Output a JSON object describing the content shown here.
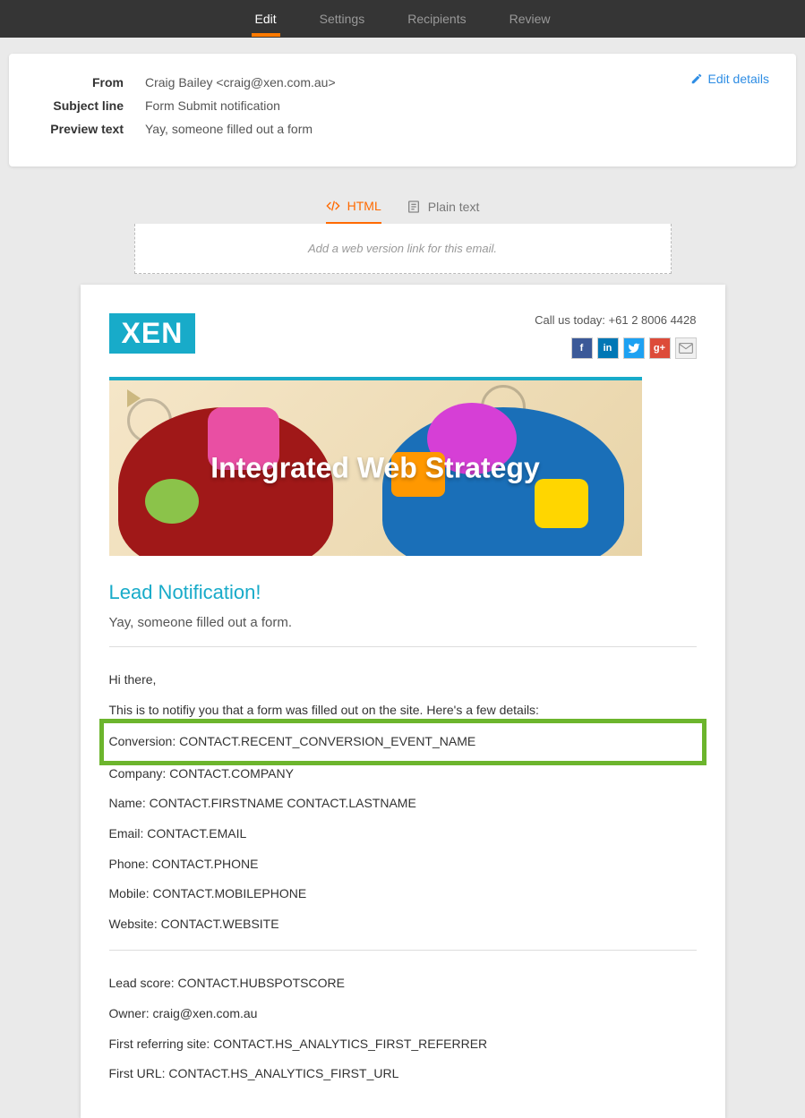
{
  "nav": {
    "tabs": [
      "Edit",
      "Settings",
      "Recipients",
      "Review"
    ],
    "active": 0
  },
  "details": {
    "from_label": "From",
    "from_value": "Craig Bailey <craig@xen.com.au>",
    "subject_label": "Subject line",
    "subject_value": "Form Submit notification",
    "preview_label": "Preview text",
    "preview_value": "Yay, someone filled out a form",
    "edit_link": "Edit details"
  },
  "view_tabs": {
    "html": "HTML",
    "plain": "Plain text"
  },
  "web_version_hint": "Add a web version link for this email.",
  "email": {
    "logo": "XEN",
    "call_us": "Call us today: +61 2 8006 4428",
    "banner_text": "Integrated Web Strategy",
    "title": "Lead Notification!",
    "subtitle": "Yay, someone filled out a form.",
    "greeting": "Hi there,",
    "intro": "This is to notifiy you that a form was filled out on the site. Here's a few details:",
    "lines": {
      "conversion": "Conversion: CONTACT.RECENT_CONVERSION_EVENT_NAME",
      "company": "Company: CONTACT.COMPANY",
      "name": "Name: CONTACT.FIRSTNAME CONTACT.LASTNAME",
      "email": "Email: CONTACT.EMAIL",
      "phone": "Phone: CONTACT.PHONE",
      "mobile": "Mobile: CONTACT.MOBILEPHONE",
      "website": "Website: CONTACT.WEBSITE",
      "leadscore": "Lead score: CONTACT.HUBSPOTSCORE",
      "owner": "Owner: craig@xen.com.au",
      "first_ref": "First referring site: CONTACT.HS_ANALYTICS_FIRST_REFERRER",
      "first_url": "First URL: CONTACT.HS_ANALYTICS_FIRST_URL"
    }
  }
}
